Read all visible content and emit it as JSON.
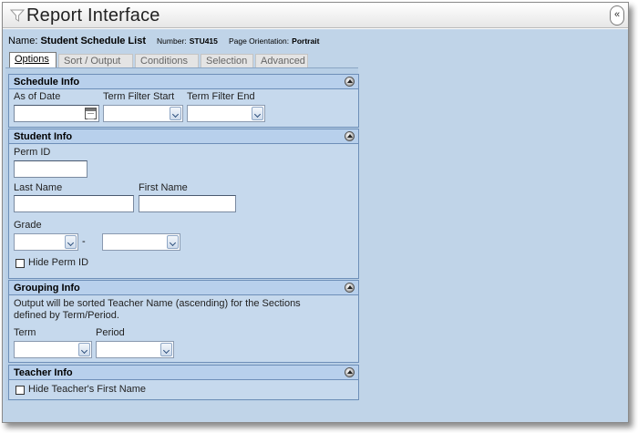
{
  "window": {
    "title": "Report Interface"
  },
  "header": {
    "name_label": "Name:",
    "name_value": "Student Schedule List",
    "number_label": "Number:",
    "number_value": "STU415",
    "orientation_label": "Page Orientation:",
    "orientation_value": "Portrait",
    "collapse_label": "«"
  },
  "tabs": [
    "Options",
    "Sort / Output",
    "Conditions",
    "Selection",
    "Advanced"
  ],
  "active_tab": "Options",
  "sections": {
    "schedule": {
      "title": "Schedule Info",
      "as_of_date_label": "As of Date",
      "as_of_date_value": "",
      "term_start_label": "Term Filter Start",
      "term_start_value": "",
      "term_end_label": "Term Filter End",
      "term_end_value": ""
    },
    "student": {
      "title": "Student Info",
      "perm_id_label": "Perm ID",
      "perm_id_value": "",
      "last_name_label": "Last Name",
      "last_name_value": "",
      "first_name_label": "First Name",
      "first_name_value": "",
      "grade_label": "Grade",
      "grade_from_value": "",
      "grade_to_value": "",
      "grade_separator": "-",
      "hide_perm_label": "Hide Perm ID",
      "hide_perm_checked": false
    },
    "grouping": {
      "title": "Grouping Info",
      "description_line1": "Output will be sorted Teacher Name (ascending) for the Sections",
      "description_line2": "defined by Term/Period.",
      "term_label": "Term",
      "term_value": "",
      "period_label": "Period",
      "period_value": ""
    },
    "teacher": {
      "title": "Teacher Info",
      "hide_first_label": "Hide Teacher's First Name",
      "hide_first_checked": false
    }
  },
  "colors": {
    "panel_bg": "#c0d4e8",
    "section_header": "#b8d0ec",
    "border": "#6e8fb8"
  }
}
